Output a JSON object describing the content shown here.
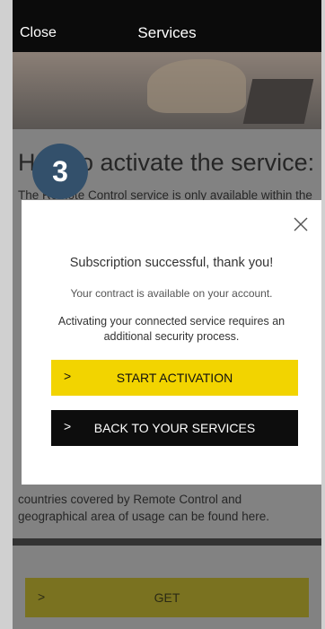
{
  "navbar": {
    "close_label": "Close",
    "title": "Services"
  },
  "background": {
    "heading": "How to activate the service:",
    "paragraph_top": "The Remote Control service is only available within the",
    "paragraph_bottom": "countries covered by Remote Control and geographical area of usage can be found here.",
    "get_label": "GET"
  },
  "step_badge": "3",
  "modal": {
    "title": "Subscription successful, thank you!",
    "subtitle": "Your contract is available on your account.",
    "note": "Activating your connected service requires an additional security process.",
    "start_activation_label": "START ACTIVATION",
    "back_label": "BACK TO YOUR SERVICES",
    "chevron": ">"
  },
  "colors": {
    "accent_yellow": "#f2d400",
    "dark": "#0d0d0d",
    "badge": "#33506b"
  }
}
